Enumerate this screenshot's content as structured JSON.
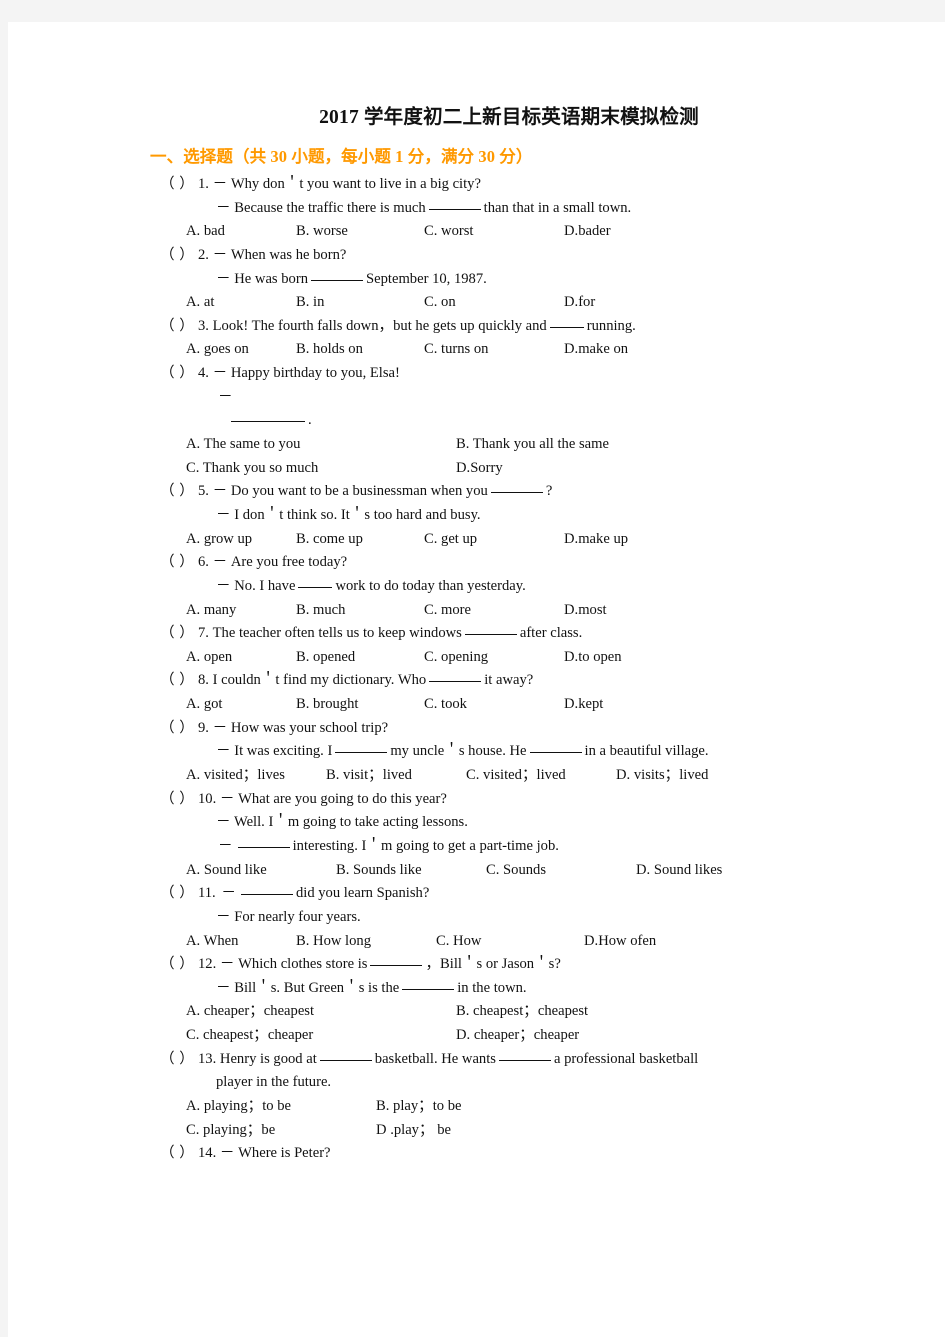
{
  "document": {
    "title": "2017 学年度初二上新目标英语期末模拟检测",
    "section_heading": "一、选择题（共 30 小题，每小题 1 分，满分 30 分）",
    "accent_color": "#ff9933",
    "text_color": "#111111",
    "page_background": "#ffffff",
    "surround_background": "#f4f4f4"
  },
  "questions": [
    {
      "number": "1.",
      "marker": "（     ）",
      "stem": "－ Why don＇t you want to live in a big city?",
      "reply": "－ Because the traffic there is much ______ than that in a small town.",
      "reply_pre": "－ Because the traffic there is much",
      "reply_post": "than that in a small town.",
      "options": [
        "A. bad",
        "B. worse",
        "C. worst",
        "D.bader"
      ],
      "layout": "four"
    },
    {
      "number": "2.",
      "marker": "（     ）",
      "stem": "－ When was he born?",
      "reply_pre": "－ He was born",
      "reply_post": "September 10, 1987.",
      "options": [
        "A. at",
        "B. in",
        "C. on",
        "D.for"
      ],
      "layout": "four"
    },
    {
      "number": "3.",
      "marker": "（     ）",
      "stem_pre": "Look! The fourth falls down，but he gets up quickly and",
      "stem_post": "running.",
      "options": [
        "A. goes on",
        "B. holds on",
        "C. turns on",
        "D.make on"
      ],
      "layout": "four"
    },
    {
      "number": "4.",
      "marker": "（     ）",
      "stem": "－ Happy birthday to you, Elsa!",
      "reply_dash": "－",
      "reply_blank_suffix": ".",
      "options": [
        "A. The same to you",
        "B. Thank you all the same",
        "C. Thank you so much",
        "D.Sorry"
      ],
      "layout": "two-wide"
    },
    {
      "number": "5.",
      "marker": "（     ）",
      "stem_pre": "－ Do you want to be a businessman when you",
      "stem_post": "?",
      "reply": "－ I don＇t think so. It＇s too hard and busy.",
      "options": [
        "A. grow up",
        "B. come up",
        "C. get up",
        "D.make up"
      ],
      "layout": "four"
    },
    {
      "number": "6.",
      "marker": "（     ）",
      "stem": "－ Are you free today?",
      "reply_pre": "－ No. I have",
      "reply_post": "work to do today than yesterday.",
      "options": [
        "A. many",
        "B. much",
        "C. more",
        "D.most"
      ],
      "layout": "four"
    },
    {
      "number": "7.",
      "marker": "（     ）",
      "stem_pre": "The teacher often tells us to keep windows",
      "stem_post": "after class.",
      "options": [
        "A. open",
        "B. opened",
        "C. opening",
        "D.to open"
      ],
      "layout": "four"
    },
    {
      "number": "8.",
      "marker": "（     ）",
      "stem_pre": "I couldn＇t find my dictionary. Who",
      "stem_post": "it away?",
      "options": [
        "A. got",
        "B. brought",
        "C. took",
        "D.kept"
      ],
      "layout": "four"
    },
    {
      "number": "9.",
      "marker": "（     ）",
      "stem": "－ How was your school trip?",
      "reply_pre": "－ It was exciting. I",
      "reply_mid": "my uncle＇s house. He",
      "reply_post": "in a beautiful village.",
      "options": [
        "A. visited；lives",
        "B. visit；lived",
        "C. visited；lived",
        "D. visits；lived"
      ],
      "layout": "four"
    },
    {
      "number": "10.",
      "marker": "（     ）",
      "stem": "－ What are you going to do this year?",
      "reply": "－ Well. I＇m going to take acting lessons.",
      "reply2_pre": "－",
      "reply2_post": "interesting. I＇m going to get a part-time job.",
      "options": [
        "A. Sound like",
        "B. Sounds like",
        "C. Sounds",
        "D. Sound likes"
      ],
      "layout": "four"
    },
    {
      "number": "11.",
      "marker": "（     ）",
      "stem_pre": "－",
      "stem_post": "did you learn Spanish?",
      "reply": "－ For nearly four years.",
      "options": [
        "A. When",
        "B. How long",
        "C. How",
        "D.How ofen"
      ],
      "layout": "four"
    },
    {
      "number": "12.",
      "marker": "（     ）",
      "stem_pre": "－ Which clothes store is",
      "stem_post": "，Bill＇s or Jason＇s?",
      "reply_pre": "－ Bill＇s. But Green＇s is the",
      "reply_post": "in the town.",
      "options": [
        "A. cheaper；cheapest",
        "B. cheapest；cheapest",
        "C. cheapest；cheaper",
        "D. cheaper；cheaper"
      ],
      "layout": "two-wide"
    },
    {
      "number": "13.",
      "marker": "（     ）",
      "stem_pre": "Henry is good at",
      "stem_mid": "basketball. He wants",
      "stem_post": "a professional basketball",
      "stem_cont": "player in the future.",
      "options": [
        "A. playing；to be",
        "B. play；to be",
        "C. playing；be",
        "D .play；  be"
      ],
      "layout": "two-narrow"
    },
    {
      "number": "14.",
      "marker": "（     ）",
      "stem": "－ Where is Peter?",
      "options": [],
      "layout": "none"
    }
  ]
}
